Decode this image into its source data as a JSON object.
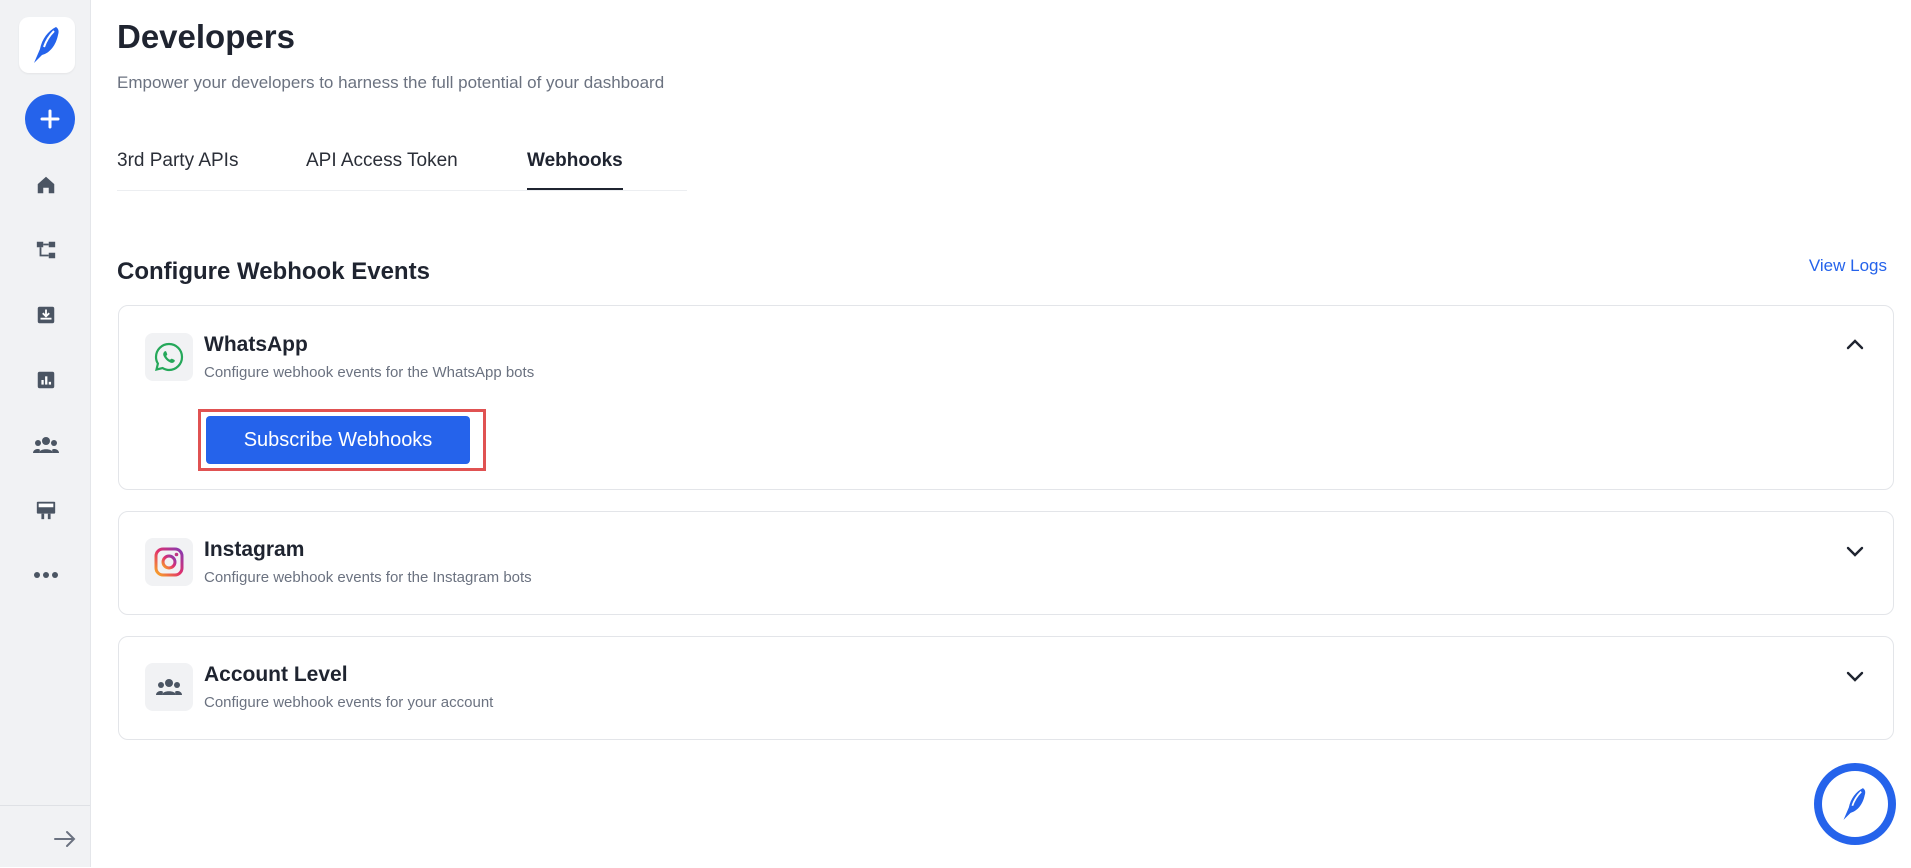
{
  "header": {
    "title": "Developers",
    "subtitle": "Empower your developers to harness the full potential of your dashboard"
  },
  "tabs": [
    {
      "label": "3rd Party APIs",
      "active": false
    },
    {
      "label": "API Access Token",
      "active": false
    },
    {
      "label": "Webhooks",
      "active": true
    }
  ],
  "section": {
    "title": "Configure Webhook Events",
    "view_logs": "View Logs"
  },
  "cards": [
    {
      "title": "WhatsApp",
      "description": "Configure webhook events for the WhatsApp bots",
      "icon": "whatsapp-icon",
      "expanded": true,
      "button_label": "Subscribe Webhooks"
    },
    {
      "title": "Instagram",
      "description": "Configure webhook events for the Instagram bots",
      "icon": "instagram-icon",
      "expanded": false
    },
    {
      "title": "Account Level",
      "description": "Configure webhook events for your account",
      "icon": "users-icon",
      "expanded": false
    }
  ],
  "sidebar": {
    "icons": [
      "home-icon",
      "flow-icon",
      "inbox-icon",
      "analytics-icon",
      "team-icon",
      "billboard-icon",
      "more-icon"
    ]
  },
  "colors": {
    "primary": "#2563eb",
    "highlight": "#e05252",
    "sidebar_bg": "#f1f2f4"
  }
}
